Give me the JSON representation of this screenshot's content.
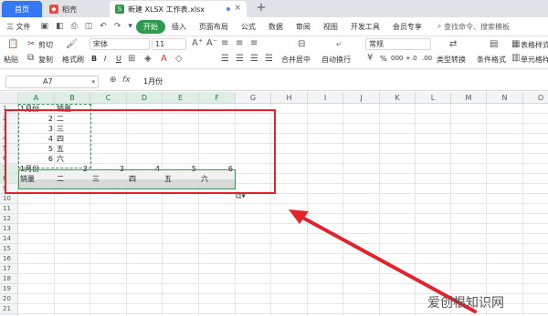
{
  "tabs": {
    "home": "首页",
    "daoke": "稻壳",
    "doc": "新建 XLSX 工作表.xlsx",
    "doc_badge": "S"
  },
  "menu": {
    "file": "三 文件",
    "items": [
      "开始",
      "插入",
      "页面布局",
      "公式",
      "数据",
      "审阅",
      "视图",
      "开发工具",
      "会员专享"
    ],
    "active_index": 0,
    "search": "查找命令、搜索模板"
  },
  "ribbon": {
    "cut": "剪切",
    "paste": "粘贴",
    "copy": "复制",
    "format_painter": "格式刷",
    "font": "宋体",
    "size": "11",
    "merge": "合并居中",
    "wrap": "自动换行",
    "num_format": "常规",
    "type_convert": "类型转换",
    "cond_format": "条件格式",
    "table_style": "表格样式",
    "cell_style": "单元格样式",
    "bold": "B",
    "italic": "I",
    "underline": "U",
    "percent": "%",
    "thousand": "000",
    "inc_dec": "+.0",
    "dec_dec": ".00"
  },
  "formula_bar": {
    "cell_ref": "A7",
    "fx": "fx",
    "content": "1月份"
  },
  "columns": [
    "A",
    "B",
    "C",
    "D",
    "E",
    "F",
    "G",
    "H",
    "I",
    "J",
    "K",
    "L",
    "M",
    "N",
    "O"
  ],
  "rows": [
    "1",
    "2",
    "3",
    "4",
    "5",
    "6",
    "7",
    "8",
    "9",
    "10",
    "11",
    "12",
    "13",
    "14",
    "15",
    "16",
    "17",
    "18",
    "19",
    "20",
    "21",
    "22"
  ],
  "source_table": {
    "header": [
      "1月份",
      "销量"
    ],
    "rows": [
      [
        "2",
        "二"
      ],
      [
        "3",
        "三"
      ],
      [
        "4",
        "四"
      ],
      [
        "5",
        "五"
      ],
      [
        "6",
        "六"
      ]
    ]
  },
  "transposed": {
    "row7": [
      "1月份",
      "2",
      "3",
      "4",
      "5",
      "6"
    ],
    "row8": [
      "销量",
      "二",
      "三",
      "四",
      "五",
      "六"
    ]
  },
  "colors": {
    "accent_green": "#2e9a4e",
    "highlight_red": "#e4222b",
    "tab_blue": "#3478f6"
  },
  "watermark": "爱创根知识网"
}
